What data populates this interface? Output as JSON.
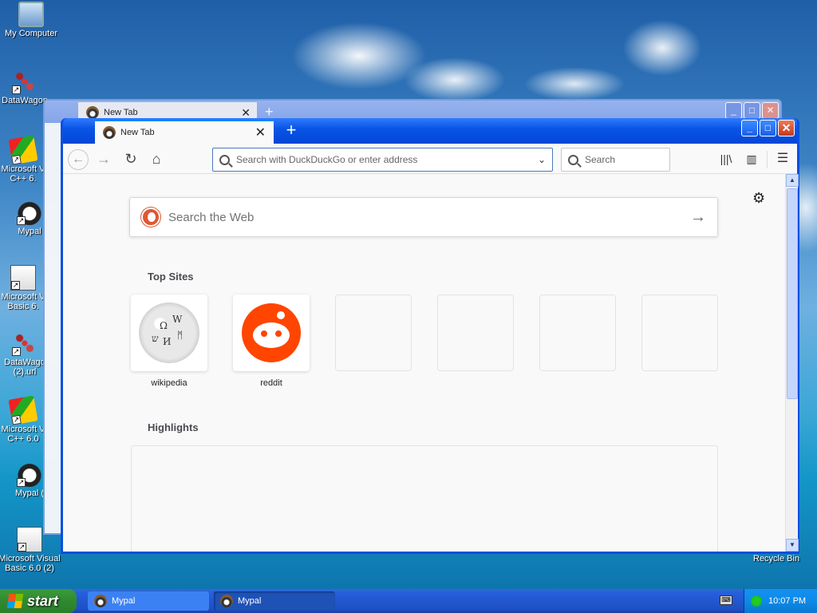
{
  "desktop": {
    "icons": [
      {
        "label": "My Computer",
        "icon": "computer-icon"
      },
      {
        "label": "DataWagon",
        "icon": "datawagon-icon"
      },
      {
        "label": "Microsoft V C++ 6.",
        "icon": "vcpp-icon"
      },
      {
        "label": "Mypal",
        "icon": "mypal-icon"
      },
      {
        "label": "Microsoft V Basic 6.",
        "icon": "vb-icon"
      },
      {
        "label": "DataWago (2).url",
        "icon": "datawagon-icon"
      },
      {
        "label": "Microsoft V C++ 6.0",
        "icon": "vcpp-icon"
      },
      {
        "label": "Mypal (",
        "icon": "mypal-icon"
      },
      {
        "label": "Microsoft Visual Basic 6.0 (2)",
        "icon": "vb-icon"
      }
    ],
    "recycle_bin_label": "Recycle Bin"
  },
  "background_window": {
    "tab_title": "New Tab",
    "tab_close": "✕",
    "new_tab": "+"
  },
  "browser": {
    "tab_title": "New Tab",
    "tab_close": "✕",
    "new_tab": "+",
    "window_controls": {
      "minimize": "_",
      "maximize": "□",
      "close": "✕"
    },
    "url_placeholder": "Search with DuckDuckGo or enter address",
    "search_placeholder": "Search",
    "nav": {
      "back": "←",
      "forward": "→",
      "reload": "↻",
      "home": "⌂",
      "dropdown": "⌄"
    },
    "toolbar": {
      "library": "|||\\",
      "sidebar": "▥",
      "menu": "☰"
    }
  },
  "newtab": {
    "web_search_placeholder": "Search the Web",
    "web_search_arrow": "→",
    "top_sites_title": "Top Sites",
    "top_sites": [
      {
        "label": "wikipedia",
        "icon": "wikipedia-icon"
      },
      {
        "label": "reddit",
        "icon": "reddit-icon"
      },
      {
        "label": "",
        "icon": ""
      },
      {
        "label": "",
        "icon": ""
      },
      {
        "label": "",
        "icon": ""
      },
      {
        "label": "",
        "icon": ""
      }
    ],
    "highlights_title": "Highlights",
    "settings_icon": "⚙"
  },
  "taskbar": {
    "start_label": "start",
    "tasks": [
      {
        "label": "Mypal",
        "active": false
      },
      {
        "label": "Mypal",
        "active": true
      }
    ],
    "clock": "10:07 PM"
  },
  "colors": {
    "titlebar_blue": "#0a55e6",
    "start_green": "#2f8a2f",
    "reddit_orange": "#ff4500",
    "ddg_orange": "#de5833"
  }
}
